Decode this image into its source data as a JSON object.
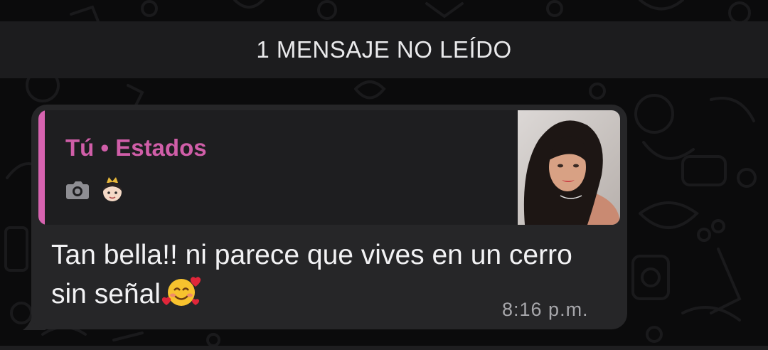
{
  "unread_banner": {
    "text": "1 MENSAJE NO LEÍDO"
  },
  "message": {
    "quote": {
      "author": "Tú • Estados",
      "media_icon": "camera-icon",
      "emoji_icon": "princess-emoji-icon",
      "accent_color": "#d763b0"
    },
    "text": "Tan bella!! ni parece que vives en un cerro sin señal",
    "emoji": "smiling-face-with-hearts-emoji",
    "time": "8:16 p.m."
  },
  "colors": {
    "background": "#0b0b0c",
    "bubble": "#262628",
    "quote_background": "#1e1e20",
    "author": "#d05ea8",
    "banner": "#1c1c1e"
  }
}
